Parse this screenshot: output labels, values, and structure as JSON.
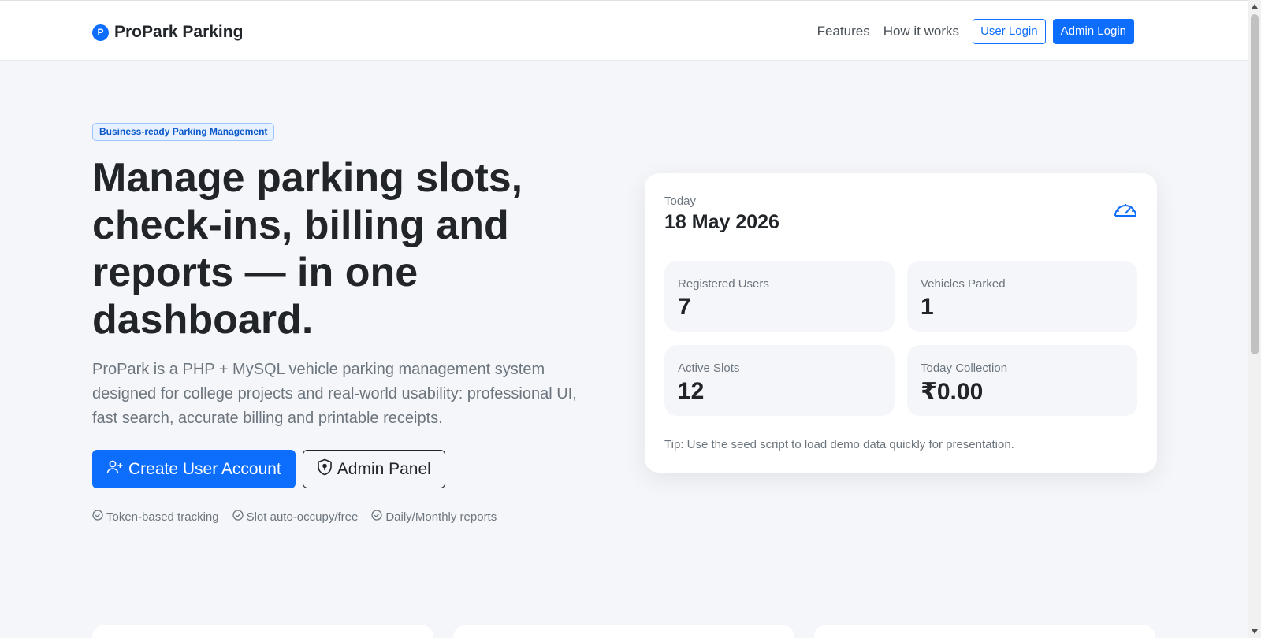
{
  "navbar": {
    "brand_icon_letter": "P",
    "brand_name": "ProPark Parking",
    "links": [
      "Features",
      "How it works"
    ],
    "user_login": "User Login",
    "admin_login": "Admin Login"
  },
  "hero": {
    "badge": "Business-ready Parking Management",
    "title": "Manage parking slots, check-ins, billing and reports — in one dashboard.",
    "lead": "ProPark is a PHP + MySQL vehicle parking management system designed for college projects and real-world usability: professional UI, fast search, accurate billing and printable receipts.",
    "cta_primary": "Create User Account",
    "cta_secondary": "Admin Panel",
    "features": [
      "Token-based tracking",
      "Slot auto-occupy/free",
      "Daily/Monthly reports"
    ]
  },
  "card": {
    "today_label": "Today",
    "today_date": "18 May 2026",
    "stats": [
      {
        "label": "Registered Users",
        "value": "7"
      },
      {
        "label": "Vehicles Parked",
        "value": "1"
      },
      {
        "label": "Active Slots",
        "value": "12"
      },
      {
        "label": "Today Collection",
        "value": "₹0.00"
      }
    ],
    "tip": "Tip: Use the seed script to load demo data quickly for presentation."
  },
  "colors": {
    "primary": "#0d6efd",
    "background": "#f5f6fa"
  }
}
